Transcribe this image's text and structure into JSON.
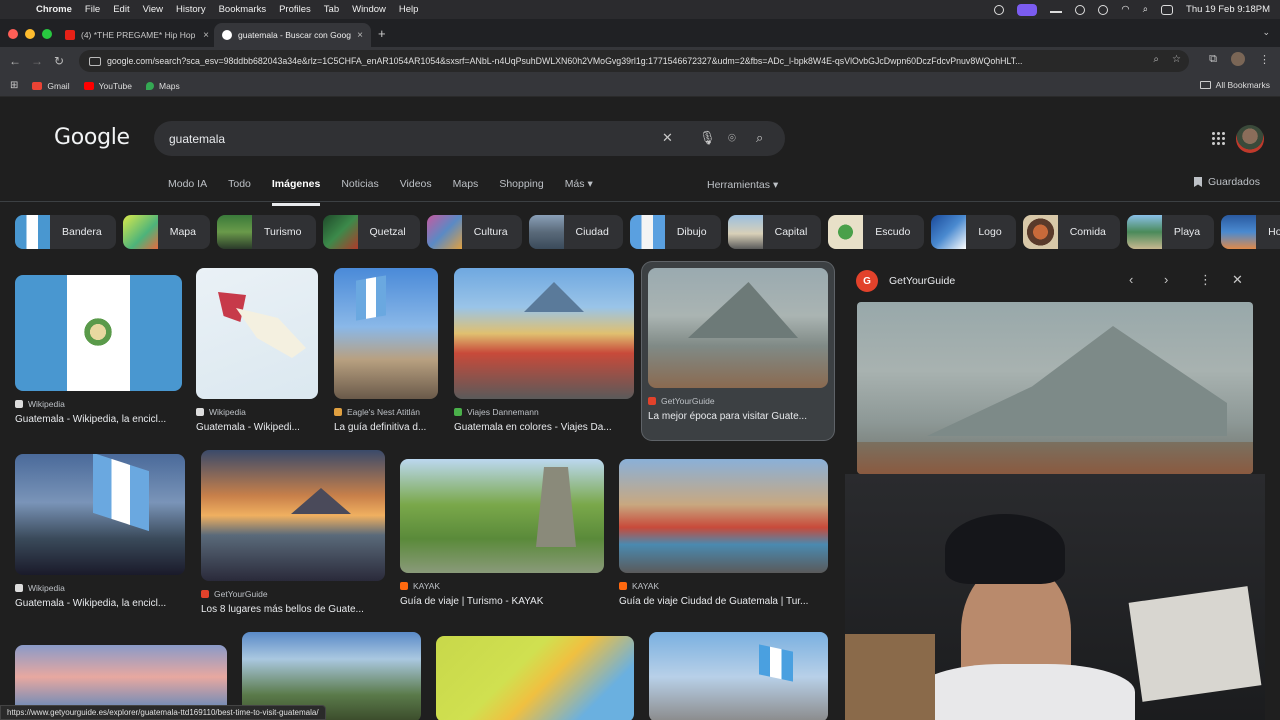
{
  "menubar": {
    "app": "Chrome",
    "items": [
      "File",
      "Edit",
      "View",
      "History",
      "Bookmarks",
      "Profiles",
      "Tab",
      "Window",
      "Help"
    ],
    "clock": "Thu 19 Feb  9:18PM"
  },
  "tabs": [
    {
      "label": "(4) *THE PREGAME* Hip Hop",
      "close": "×"
    },
    {
      "label": "guatemala - Buscar con Goog",
      "close": "×"
    }
  ],
  "new_tab": "+",
  "toolbar": {
    "url": "google.com/search?sca_esv=98ddbb682043a34e&rlz=1C5CHFA_enAR1054AR1054&sxsrf=ANbL-n4UqPsuhDWLXN60h2VMoGvg39rl1g:1771546672327&udm=2&fbs=ADc_l-bpk8W4E-qsVlOvbGJcDwpn60DczFdcvPnuv8WQohHLT..."
  },
  "bookmarks": {
    "items": [
      "Gmail",
      "YouTube",
      "Maps"
    ],
    "all": "All Bookmarks"
  },
  "google": {
    "logo": "Google",
    "query": "guatemala",
    "nav": [
      "Modo IA",
      "Todo",
      "Imágenes",
      "Noticias",
      "Videos",
      "Maps",
      "Shopping",
      "Más ▾"
    ],
    "tools": "Herramientas ▾",
    "saved": "Guardados"
  },
  "chips": [
    "Bandera",
    "Mapa",
    "Turismo",
    "Quetzal",
    "Cultura",
    "Ciudad",
    "Dibujo",
    "Capital",
    "Escudo",
    "Logo",
    "Comida",
    "Playa",
    "Hotel"
  ],
  "results_row1": [
    {
      "source": "Wikipedia",
      "title": "Guatemala - Wikipedia, la encicl..."
    },
    {
      "source": "Wikipedia",
      "title": "Guatemala - Wikipedi..."
    },
    {
      "source": "Eagle's Nest Atitlán",
      "title": "La guía definitiva d..."
    },
    {
      "source": "Viajes Dannemann",
      "title": "Guatemala en colores - Viajes Da..."
    },
    {
      "source": "GetYourGuide",
      "title": "La mejor época para visitar Guate..."
    }
  ],
  "results_row2": [
    {
      "source": "Wikipedia",
      "title": "Guatemala - Wikipedia, la encicl..."
    },
    {
      "source": "GetYourGuide",
      "title": "Los 8 lugares más bellos de Guate..."
    },
    {
      "source": "KAYAK",
      "title": "Guía de viaje | Turismo - KAYAK"
    },
    {
      "source": "KAYAK",
      "title": "Guía de viaje Ciudad de Guatemala | Tur..."
    }
  ],
  "panel": {
    "source": "GetYourGuide"
  },
  "statusbar": "https://www.getyourguide.es/explorer/guatemala-ttd169110/best-time-to-visit-guatemala/"
}
